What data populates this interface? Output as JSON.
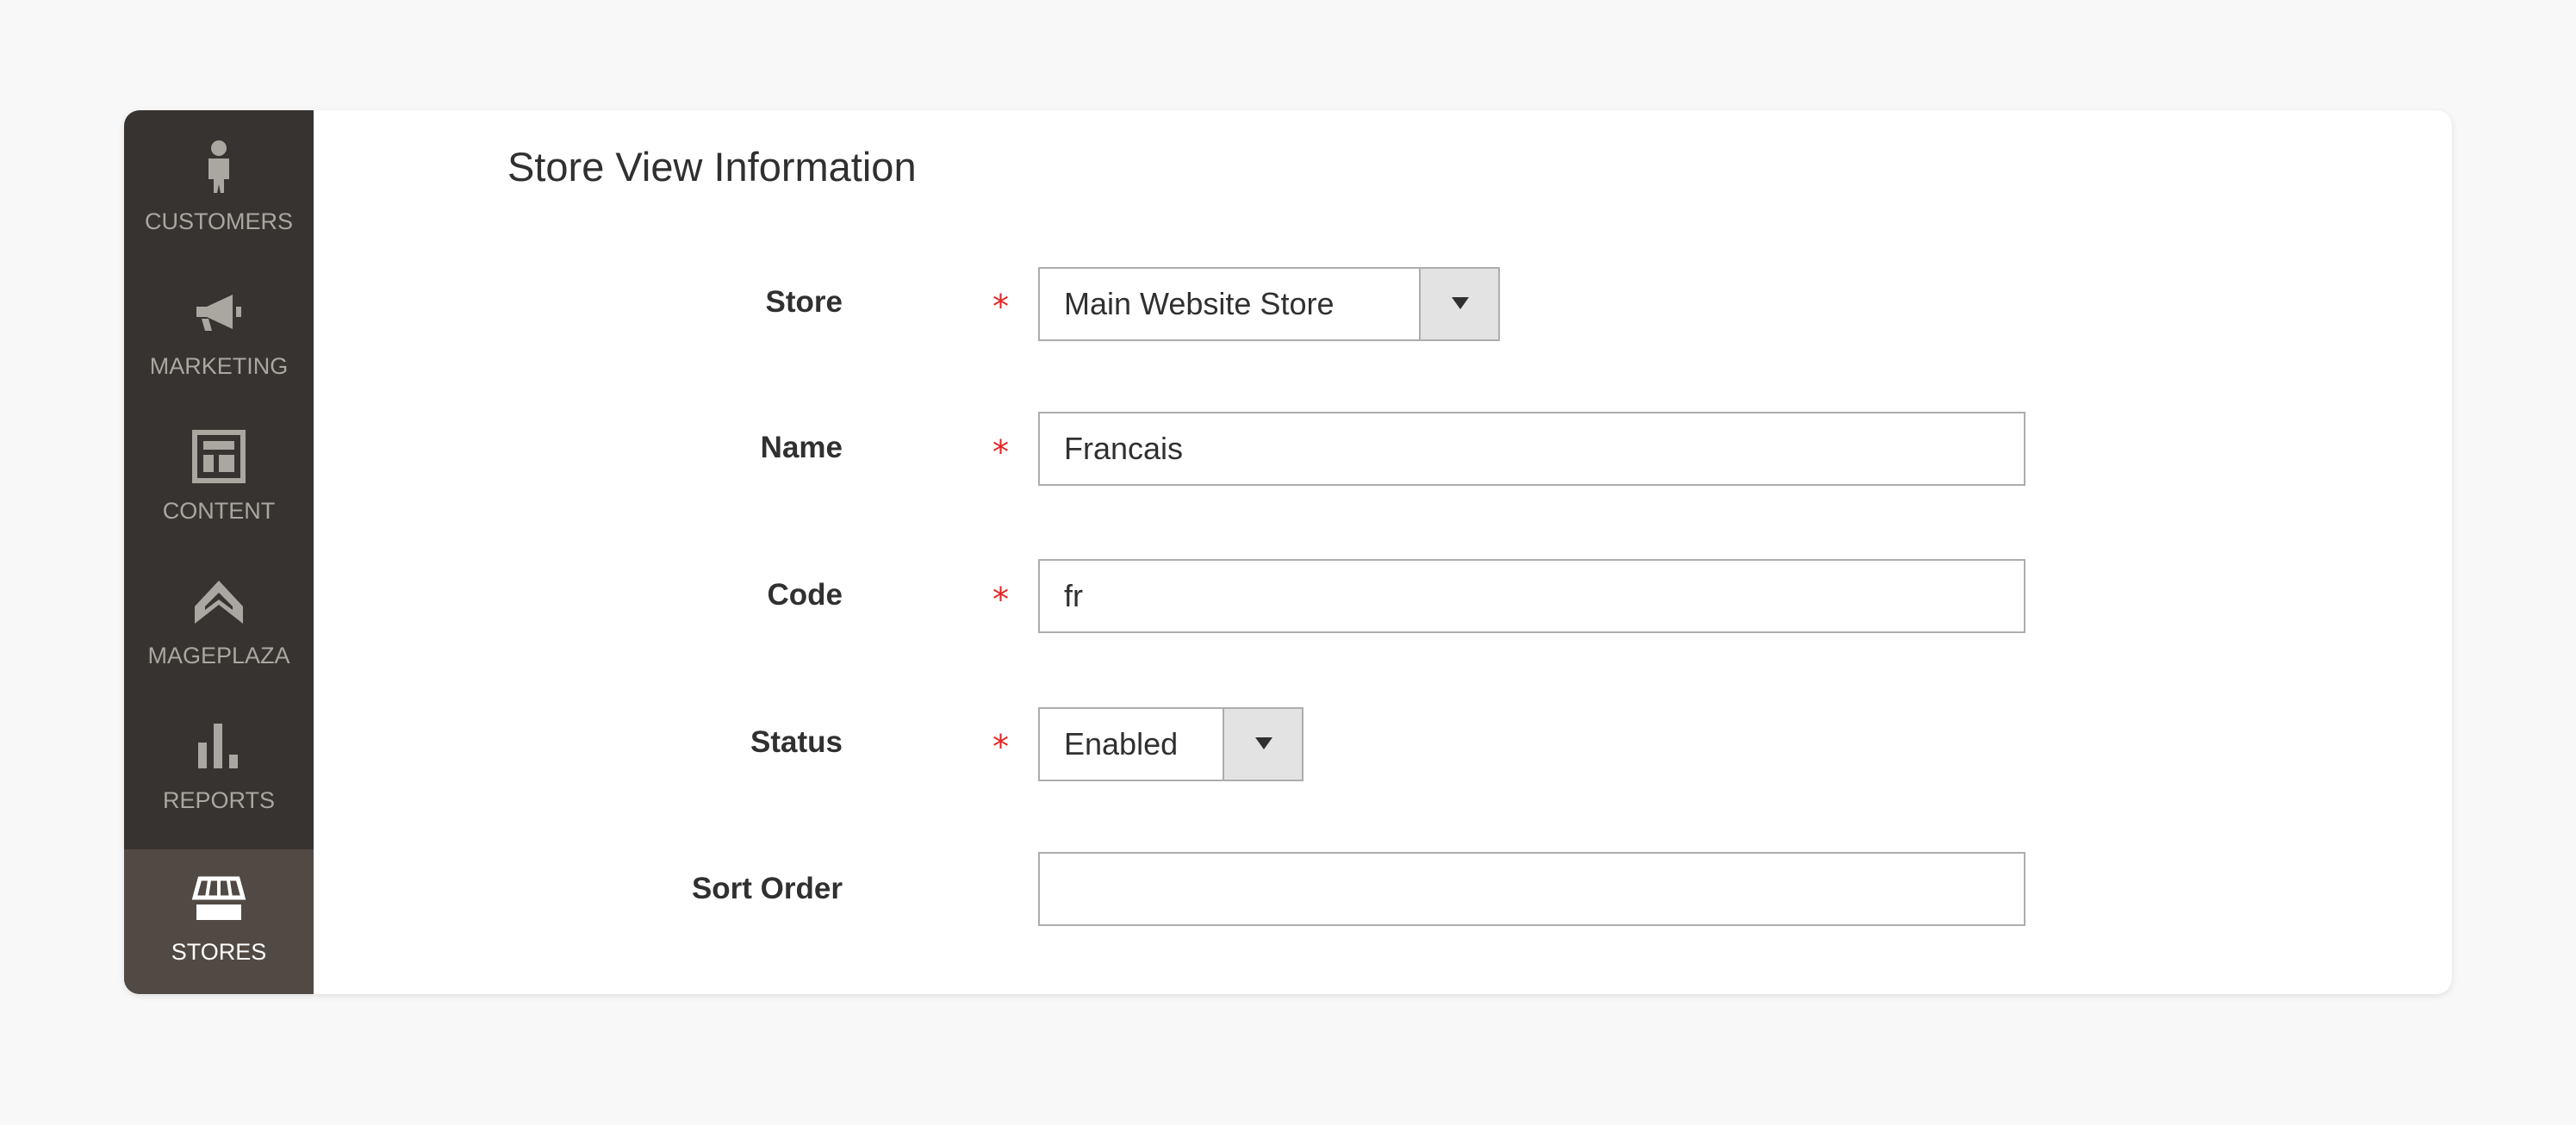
{
  "sidebar": {
    "items": [
      {
        "label": "CUSTOMERS",
        "icon": "customers-icon",
        "active": false
      },
      {
        "label": "MARKETING",
        "icon": "megaphone-icon",
        "active": false
      },
      {
        "label": "CONTENT",
        "icon": "content-layout-icon",
        "active": false
      },
      {
        "label": "MAGEPLAZA",
        "icon": "mageplaza-logo-icon",
        "active": false
      },
      {
        "label": "REPORTS",
        "icon": "bar-chart-icon",
        "active": false
      },
      {
        "label": "STORES",
        "icon": "storefront-icon",
        "active": true
      }
    ]
  },
  "section": {
    "title": "Store View Information"
  },
  "form": {
    "store": {
      "label": "Store",
      "required": true,
      "value": "Main Website Store"
    },
    "name": {
      "label": "Name",
      "required": true,
      "value": "Francais"
    },
    "code": {
      "label": "Code",
      "required": true,
      "value": "fr"
    },
    "status": {
      "label": "Status",
      "required": true,
      "value": "Enabled"
    },
    "sort_order": {
      "label": "Sort Order",
      "required": false,
      "value": ""
    },
    "required_marker": "*"
  },
  "colors": {
    "page_background": "#f8f8f8",
    "sidebar_background": "#373330",
    "sidebar_active_background": "#514943",
    "sidebar_text": "#aaa6a0",
    "required_marker": "#e22626",
    "text": "#303030",
    "input_border": "#adadad"
  }
}
